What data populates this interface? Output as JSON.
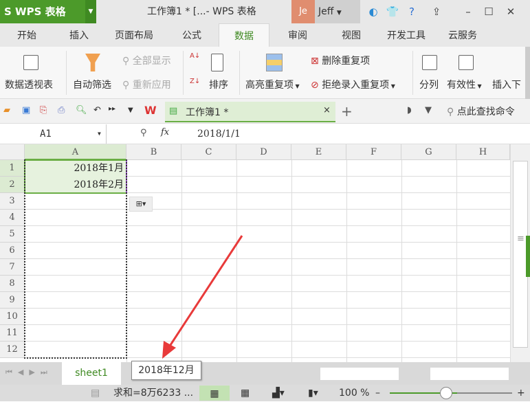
{
  "app": {
    "logo": "S WPS 表格",
    "window_title": "工作簿1 * [...- WPS 表格",
    "avatar": "Je",
    "user": "Jeff"
  },
  "tabs": [
    {
      "label": "开始"
    },
    {
      "label": "插入"
    },
    {
      "label": "页面布局"
    },
    {
      "label": "公式"
    },
    {
      "label": "数据",
      "active": true
    },
    {
      "label": "审阅"
    },
    {
      "label": "视图"
    },
    {
      "label": "开发工具"
    },
    {
      "label": "云服务"
    }
  ],
  "ribbon": {
    "pivot": "数据透视表",
    "autofilter": "自动筛选",
    "show_all": "全部显示",
    "reapply": "重新应用",
    "sort": "排序",
    "highlight_dup": "高亮重复项",
    "remove_dup": "删除重复项",
    "reject_dup": "拒绝录入重复项",
    "split": "分列",
    "validity": "有效性",
    "insert_dd": "插入下"
  },
  "doc_tab": {
    "label": "工作簿1 *",
    "close": "×",
    "add": "+"
  },
  "search_cmd": "点此查找命令",
  "formula_bar": {
    "name_box": "A1",
    "fx": "fx",
    "value": "2018/1/1"
  },
  "columns": [
    "A",
    "B",
    "C",
    "D",
    "E",
    "F",
    "G",
    "H"
  ],
  "rows": [
    "1",
    "2",
    "3",
    "4",
    "5",
    "6",
    "7",
    "8",
    "9",
    "10",
    "11",
    "12"
  ],
  "cells": {
    "A1": "2018年1月",
    "A2": "2018年2月"
  },
  "sheet": {
    "tab": "sheet1",
    "tooltip": "2018年12月"
  },
  "status": {
    "sum": "求和=8万6233 ...",
    "zoom": "100 %"
  },
  "colors": {
    "accent": "#4c9a2a",
    "arrow": "#e83a3a"
  }
}
